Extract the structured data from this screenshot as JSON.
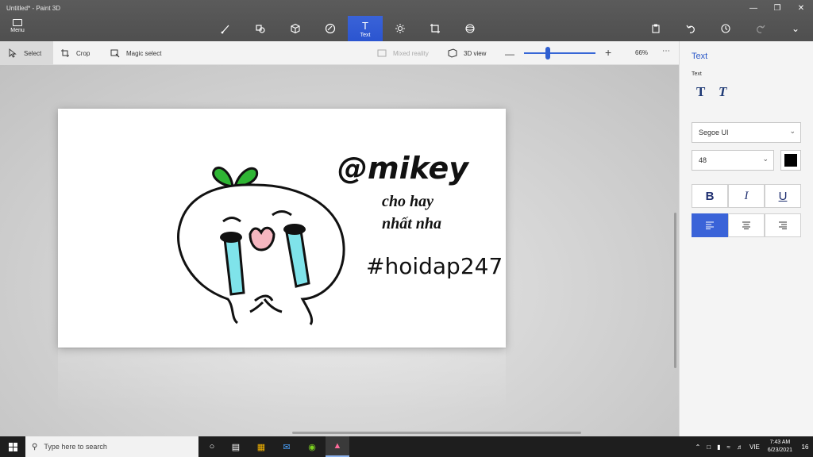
{
  "window": {
    "title": "Untitled* - Paint 3D"
  },
  "menu": {
    "label": "Menu"
  },
  "toolbar": {
    "active_tool_label": "Text"
  },
  "subbar": {
    "select_label": "Select",
    "crop_label": "Crop",
    "magic_select_label": "Magic select",
    "mixed_reality_label": "Mixed reality",
    "view3d_label": "3D view",
    "zoom_value": "66%",
    "zoom_fraction": 0.33
  },
  "canvas": {
    "line1": "@mikey",
    "line2": "cho hay",
    "line3": "nhất nha",
    "line4": "#hoidap247"
  },
  "panel": {
    "title": "Text",
    "section_label": "Text",
    "font": "Segoe UI",
    "size": "48",
    "color": "#000000",
    "bold_label": "B",
    "italic_label": "I",
    "underline_label": "U",
    "text_type_plain": "T",
    "text_type_fancy": "T"
  },
  "taskbar": {
    "search_placeholder": "Type here to search",
    "language": "VIE",
    "time": "7:43 AM",
    "date": "6/23/2021",
    "notifications": "16"
  },
  "colors": {
    "accent": "#3a63d8",
    "titlebar": "#555555"
  }
}
